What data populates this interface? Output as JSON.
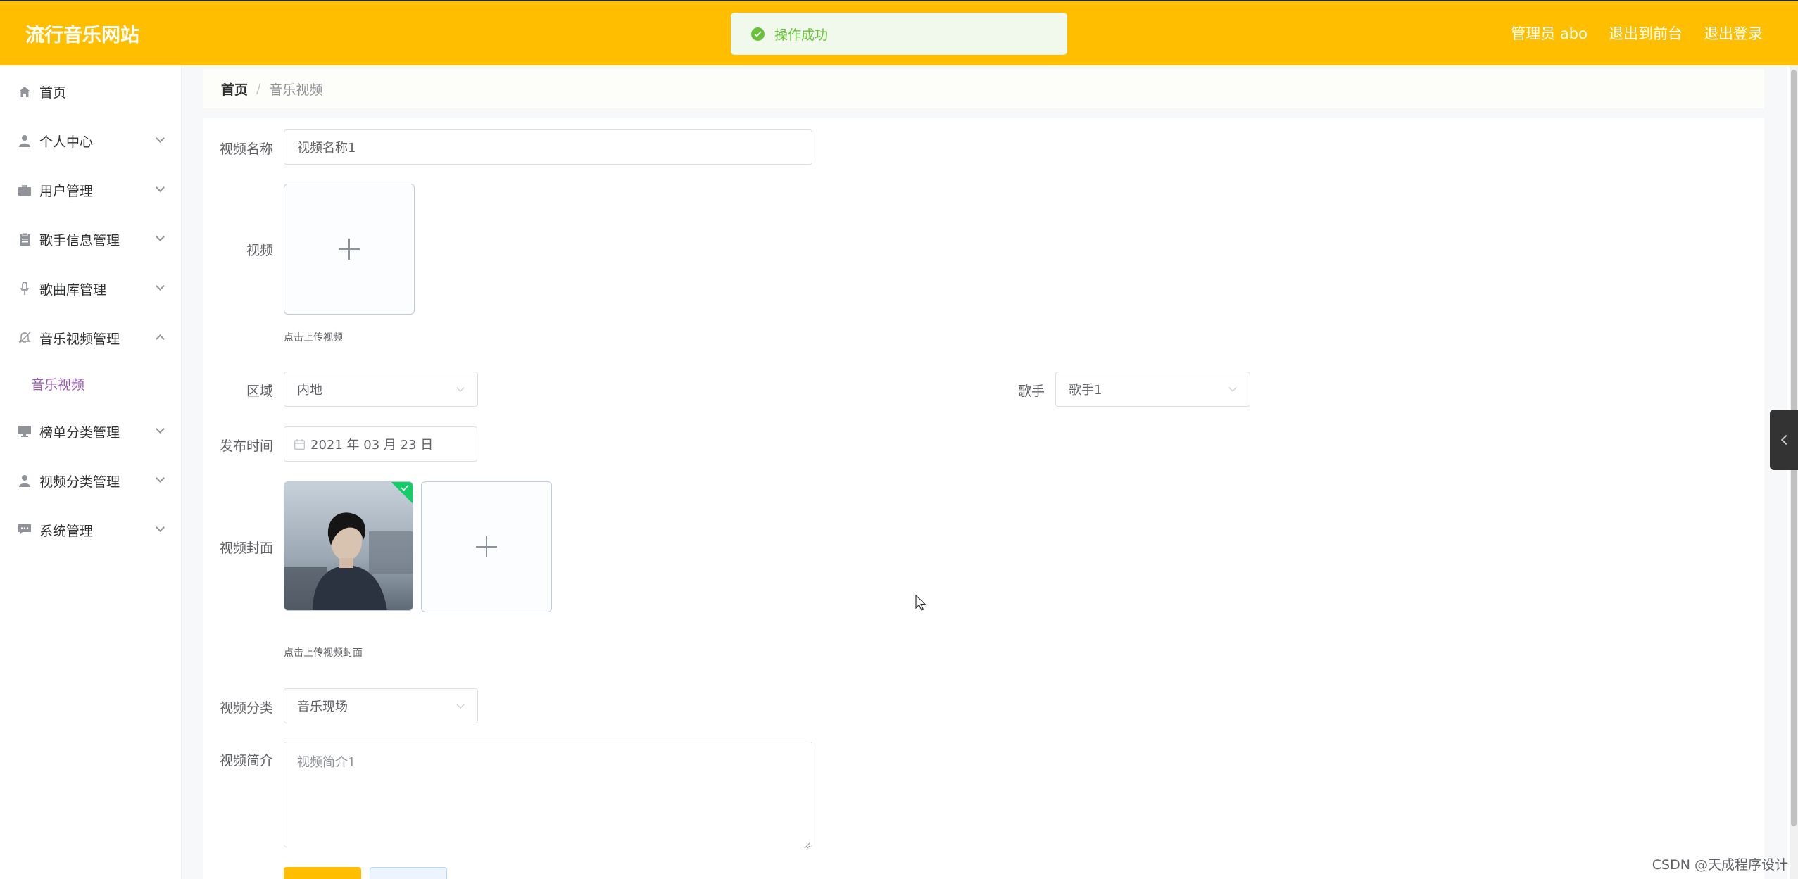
{
  "header": {
    "brand": "流行音乐网站",
    "admin": "管理员 abo",
    "to_front": "退出到前台",
    "logout": "退出登录"
  },
  "toast": {
    "message": "操作成功"
  },
  "sidebar": {
    "items": [
      {
        "label": "首页",
        "icon": "home-icon"
      },
      {
        "label": "个人中心",
        "icon": "user-icon"
      },
      {
        "label": "用户管理",
        "icon": "briefcase-icon"
      },
      {
        "label": "歌手信息管理",
        "icon": "clipboard-icon"
      },
      {
        "label": "歌曲库管理",
        "icon": "microphone-icon"
      },
      {
        "label": "音乐视频管理",
        "icon": "bell-off-icon"
      },
      {
        "label": "榜单分类管理",
        "icon": "monitor-icon"
      },
      {
        "label": "视频分类管理",
        "icon": "user-icon"
      },
      {
        "label": "系统管理",
        "icon": "chat-icon"
      }
    ],
    "sub_active": "音乐视频"
  },
  "breadcrumb": {
    "home": "首页",
    "sep": "/",
    "current": "音乐视频"
  },
  "form": {
    "video_name_label": "视频名称",
    "video_name_value": "视频名称1",
    "video_label": "视频",
    "video_hint": "点击上传视频",
    "region_label": "区域",
    "region_value": "内地",
    "singer_label": "歌手",
    "singer_value": "歌手1",
    "publish_label": "发布时间",
    "publish_value": "2021 年 03 月 23 日",
    "cover_label": "视频封面",
    "cover_hint": "点击上传视频封面",
    "category_label": "视频分类",
    "category_value": "音乐现场",
    "intro_label": "视频简介",
    "intro_value": "视频简介1"
  },
  "colors": {
    "header": "#ffbf00",
    "active_sub": "#9b59b6",
    "success": "#67c23a"
  },
  "watermark": "CSDN @天成程序设计"
}
